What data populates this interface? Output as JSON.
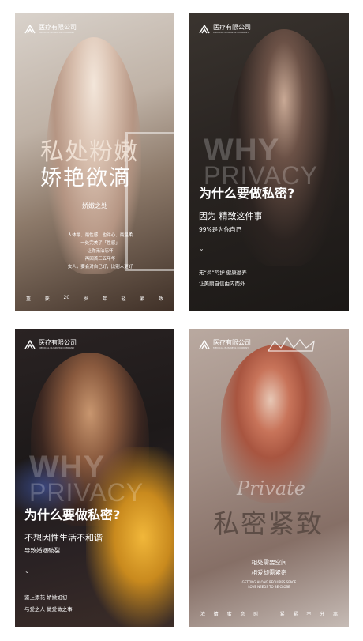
{
  "logo": {
    "name": "医疗有限公司",
    "sub": "MEDICAL BUSINESS COMPANY"
  },
  "poster1": {
    "title_line1": "私处粉嫩",
    "title_line2": "娇艳欲滴",
    "subtitle": "娇嫩之处",
    "poem": [
      "人体最、最性感、也许心、最温柔",
      "一处完美了「性感」",
      "让你无法忘怀",
      "再回首三五年华",
      "女人，要会对自己好，比别人更好"
    ],
    "footer": [
      "重",
      "获",
      "20",
      "岁",
      "年",
      "轻",
      "紧",
      "致"
    ]
  },
  "poster2": {
    "why": "WHY",
    "privacy": "PRIVACY",
    "question": "为什么要做私密?",
    "answer": "因为 精致这件事",
    "answer2": "99%是为你自己",
    "chevron": "⌄",
    "line1": "无“炎”呵护 健康滋养",
    "line2": "让美丽自信由内而外"
  },
  "poster3": {
    "why": "WHY",
    "privacy": "PRIVACY",
    "question": "为什么要做私密?",
    "answer": "不想因性生活不和谐",
    "answer2": "导致婚姻破裂",
    "chevron": "⌄",
    "line1": "紧上添花 娇嫩如初",
    "line2": "与爱之人 做爱做之事"
  },
  "poster4": {
    "script": "Private",
    "title": "私密紧致",
    "line1": "相处需要空间",
    "line2": "相爱却需紧密",
    "en1": "GETTING ALONG REQUIRES SPACE",
    "en2": "LOVE NEEDS TO BE CLOSE",
    "footer": [
      "浓",
      "情",
      "蜜",
      "意",
      "时",
      "，",
      "紧",
      "紧",
      "不",
      "分",
      "离"
    ]
  }
}
